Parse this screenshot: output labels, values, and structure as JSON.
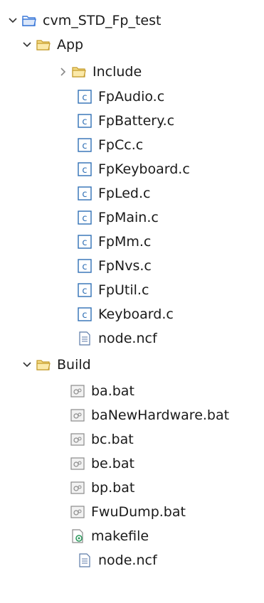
{
  "tree": {
    "root": {
      "label": "cvm_STD_Fp_test",
      "expanded": true
    },
    "app": {
      "label": "App",
      "expanded": true,
      "include": {
        "label": "Include",
        "expanded": false
      },
      "files": [
        "FpAudio.c",
        "FpBattery.c",
        "FpCc.c",
        "FpKeyboard.c",
        "FpLed.c",
        "FpMain.c",
        "FpMm.c",
        "FpNvs.c",
        "FpUtil.c",
        "Keyboard.c"
      ],
      "node_file": "node.ncf"
    },
    "build": {
      "label": "Build",
      "expanded": true,
      "bat_files": [
        "ba.bat",
        "baNewHardware.bat",
        "bc.bat",
        "be.bat",
        "bp.bat",
        "FwuDump.bat"
      ],
      "makefile": "makefile",
      "node_file": "node.ncf"
    }
  },
  "colors": {
    "folder_blue": "#3b78d8",
    "folder_yellow": "#e8c75a",
    "chevron": "#333333",
    "c_icon_blue": "#2f6fb5",
    "text": "#1a1a1a"
  },
  "icons": {
    "chevron_expanded": "chevron-down-icon",
    "chevron_collapsed": "chevron-right-icon",
    "project": "project-folder-icon",
    "folder": "folder-open-icon",
    "c_file": "c-source-file-icon",
    "text_file": "text-file-icon",
    "bat_file": "batch-file-icon",
    "makefile": "makefile-icon"
  }
}
